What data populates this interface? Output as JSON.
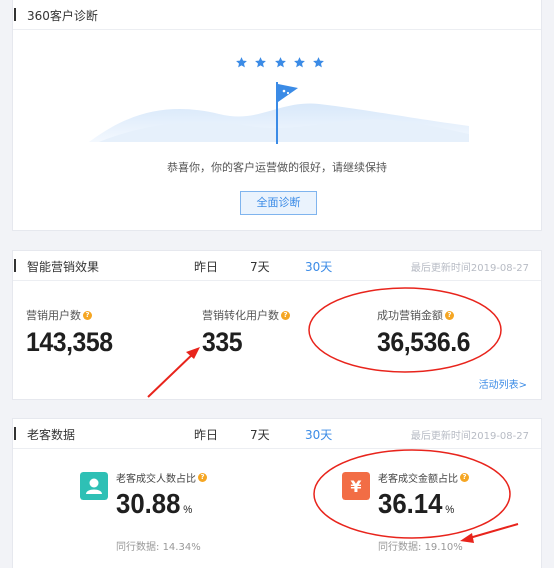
{
  "diagnosis": {
    "title": "360客户诊断",
    "message": "恭喜你，你的客户运营做的很好，请继续保持",
    "button_label": "全面诊断"
  },
  "marketing": {
    "title": "智能营销效果",
    "tabs": [
      "昨日",
      "7天",
      "30天"
    ],
    "active_tab": "30天",
    "updated": "最后更新时间2019-08-27",
    "metrics": [
      {
        "label": "营销用户数",
        "value": "143,358"
      },
      {
        "label": "营销转化用户数",
        "value": "335"
      },
      {
        "label": "成功营销金额",
        "value": "36,536.6"
      }
    ],
    "activity_link": "活动列表>"
  },
  "old_customers": {
    "title": "老客数据",
    "tabs": [
      "昨日",
      "7天",
      "30天"
    ],
    "active_tab": "30天",
    "updated": "最后更新时间2019-08-27",
    "ratios": [
      {
        "label": "老客成交人数占比",
        "value": "30.88",
        "unit": "%",
        "peer_label": "同行数据:",
        "peer_value": "14.34%",
        "icon": "user-icon",
        "color": "#2ec0b5"
      },
      {
        "label": "老客成交金额占比",
        "value": "36.14",
        "unit": "%",
        "peer_label": "同行数据:",
        "peer_value": "19.10%",
        "icon": "yuan-icon",
        "color": "#f26d45"
      }
    ]
  },
  "colors": {
    "accent": "#3b8be6",
    "annotation": "#e8241c",
    "info": "#f5a623"
  }
}
